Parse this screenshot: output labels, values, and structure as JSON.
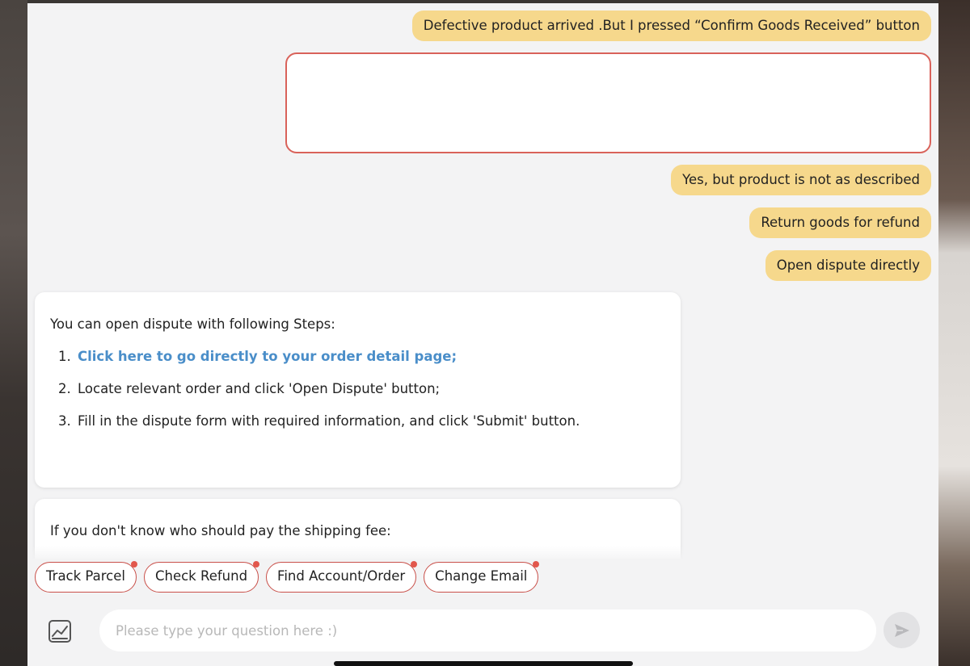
{
  "user_messages": [
    "Defective product arrived .But I pressed “Confirm Goods Received” button",
    "Yes, but product is not as described",
    "Return goods for refund",
    "Open dispute directly"
  ],
  "bot_messages": {
    "dispute_steps": {
      "intro": "You can open dispute with following Steps:",
      "steps": [
        {
          "num": "1.",
          "text": "Click here to go directly to your order detail page;"
        },
        {
          "num": "2.",
          "text": "Locate relevant order and click 'Open Dispute' button;"
        },
        {
          "num": "3.",
          "text": "Fill in the dispute form with required information, and click 'Submit' button."
        }
      ]
    },
    "shipping_fee": {
      "intro": "If you don't know who should pay the shipping fee:"
    }
  },
  "quick_replies": [
    {
      "label": "Track Parcel",
      "has_dot": true
    },
    {
      "label": "Check Refund",
      "has_dot": true
    },
    {
      "label": "Find Account/Order",
      "has_dot": true
    },
    {
      "label": "Change Email",
      "has_dot": true
    }
  ],
  "input": {
    "placeholder": "Please type your question here :)",
    "value": ""
  },
  "icons": {
    "attach": "chart-icon",
    "send": "send-icon"
  },
  "colors": {
    "user_bubble": "#f6d88c",
    "accent_red": "#d9625a",
    "link_blue": "#4a8ec9",
    "panel_bg": "#f3f3f4"
  }
}
